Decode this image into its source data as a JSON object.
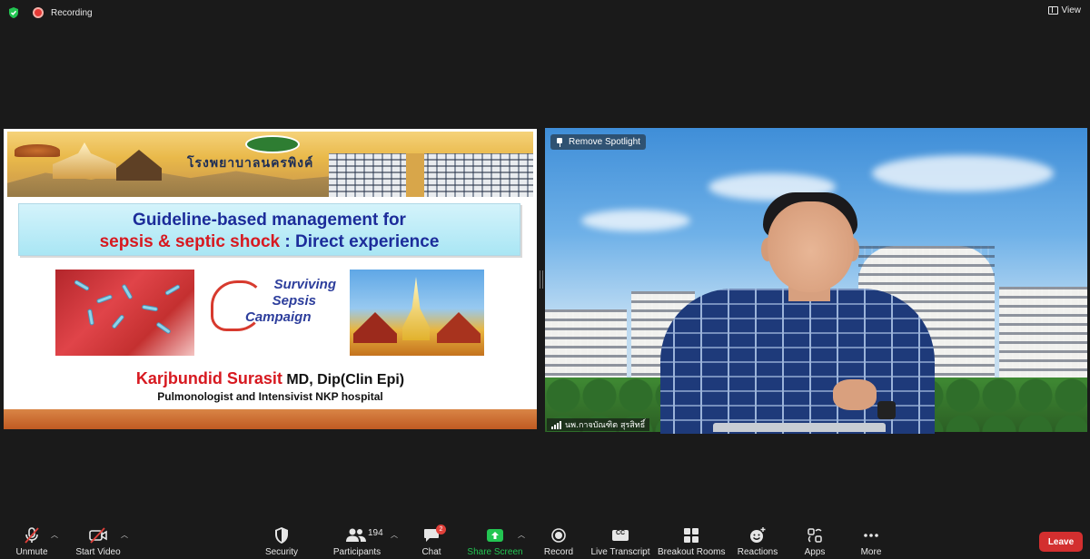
{
  "topbar": {
    "recording_label": "Recording",
    "view_label": "View"
  },
  "slide": {
    "hospital_name": "โรงพยาบาลนครพิงค์",
    "title_line1": "Guideline-based management for",
    "title_line2_red": "sepsis & septic shock",
    "title_line2_blue": " : Direct experience",
    "campaign_line1": "Surviving",
    "campaign_line2": "Sepsis",
    "campaign_line3": "Campaign",
    "presenter_name": "Karjbundid Surasit",
    "presenter_credentials": " MD, Dip(Clin Epi)",
    "presenter_role": "Pulmonologist and Intensivist NKP hospital"
  },
  "video": {
    "spotlight_label": "Remove Spotlight",
    "participant_name": "นพ.กาจบัณฑิต สุรสิทธิ์"
  },
  "toolbar": {
    "unmute": "Unmute",
    "start_video": "Start Video",
    "security": "Security",
    "participants": "Participants",
    "participants_count": "194",
    "chat": "Chat",
    "chat_badge": "2",
    "share_screen": "Share Screen",
    "record": "Record",
    "live_transcript": "Live Transcript",
    "breakout_rooms": "Breakout Rooms",
    "reactions": "Reactions",
    "apps": "Apps",
    "more": "More",
    "leave": "Leave",
    "cc_text": "CC"
  },
  "colors": {
    "share_green": "#23c552",
    "leave_red": "#d32f2f",
    "badge_red": "#e0403a"
  }
}
